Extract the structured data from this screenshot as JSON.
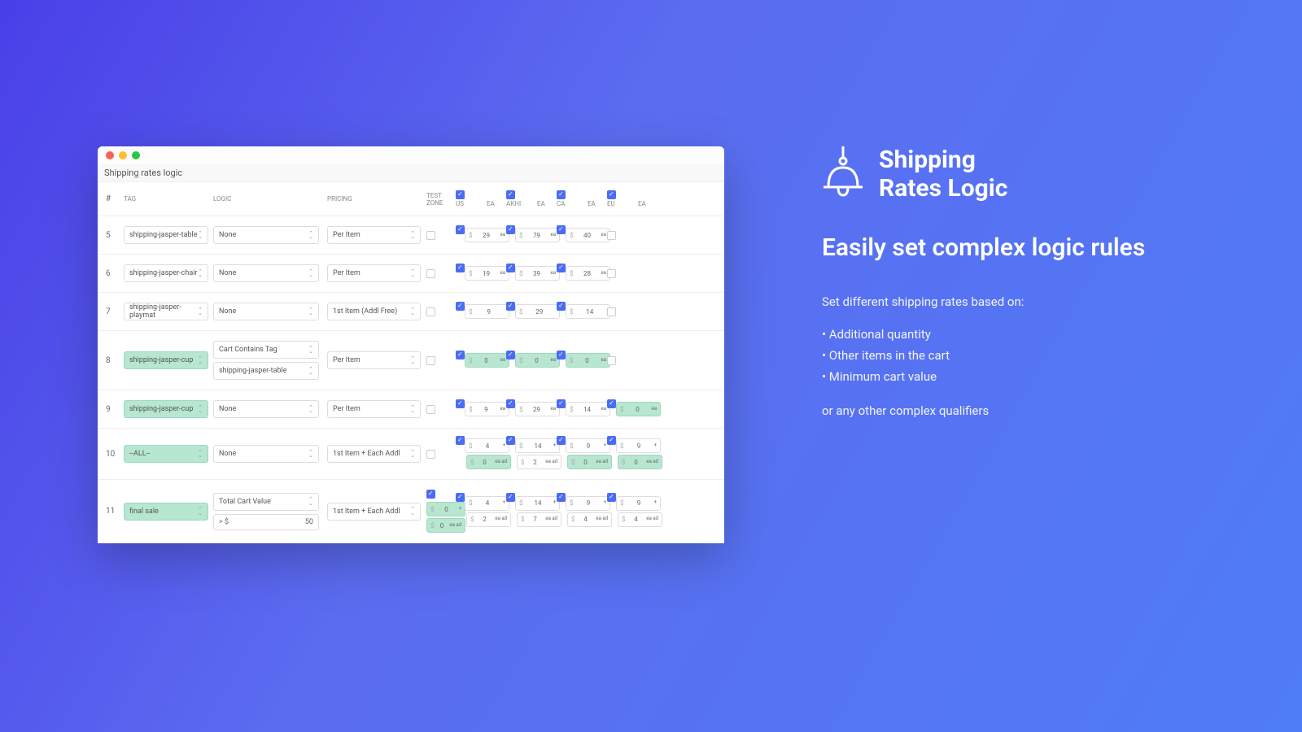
{
  "window": {
    "title": "Shipping rates logic"
  },
  "headers": {
    "num": "#",
    "tag": "TAG",
    "logic": "LOGIC",
    "pricing": "PRICING",
    "test": "TEST ZONE"
  },
  "zone_headers": [
    {
      "checked": true,
      "label": "US",
      "unit": "ea"
    },
    {
      "checked": true,
      "label": "AKHI",
      "unit": "ea"
    },
    {
      "checked": true,
      "label": "CA",
      "unit": "ea"
    },
    {
      "checked": true,
      "label": "EU",
      "unit": "ea"
    }
  ],
  "rows": [
    {
      "num": "5",
      "tag": "shipping-jasper-table",
      "tag_green": false,
      "logic": [
        {
          "text": "None",
          "sel": true
        }
      ],
      "pricing": "Per Item",
      "test": {
        "check": false,
        "prices": []
      },
      "zones": [
        {
          "checked": true,
          "boxes": [
            {
              "v": "29",
              "u": "ea"
            }
          ]
        },
        {
          "checked": true,
          "boxes": [
            {
              "v": "79",
              "u": "ea"
            }
          ]
        },
        {
          "checked": true,
          "boxes": [
            {
              "v": "40",
              "u": "ea"
            }
          ]
        },
        {
          "checked": false,
          "boxes": []
        }
      ]
    },
    {
      "num": "6",
      "tag": "shipping-jasper-chair",
      "tag_green": false,
      "logic": [
        {
          "text": "None",
          "sel": true
        }
      ],
      "pricing": "Per Item",
      "test": {
        "check": false,
        "prices": []
      },
      "zones": [
        {
          "checked": true,
          "boxes": [
            {
              "v": "19",
              "u": "ea"
            }
          ]
        },
        {
          "checked": true,
          "boxes": [
            {
              "v": "39",
              "u": "ea"
            }
          ]
        },
        {
          "checked": true,
          "boxes": [
            {
              "v": "28",
              "u": "ea"
            }
          ]
        },
        {
          "checked": false,
          "boxes": []
        }
      ]
    },
    {
      "num": "7",
      "tag": "shipping-jasper-playmat",
      "tag_green": false,
      "logic": [
        {
          "text": "None",
          "sel": true
        }
      ],
      "pricing": "1st Item (Addl Free)",
      "test": {
        "check": false,
        "prices": []
      },
      "zones": [
        {
          "checked": true,
          "boxes": [
            {
              "v": "9",
              "u": ""
            }
          ]
        },
        {
          "checked": true,
          "boxes": [
            {
              "v": "29",
              "u": ""
            }
          ]
        },
        {
          "checked": true,
          "boxes": [
            {
              "v": "14",
              "u": ""
            }
          ]
        },
        {
          "checked": false,
          "boxes": []
        }
      ]
    },
    {
      "num": "8",
      "tag": "shipping-jasper-cup",
      "tag_green": true,
      "logic": [
        {
          "text": "Cart Contains Tag",
          "sel": true
        },
        {
          "text": "shipping-jasper-table",
          "sel": true
        }
      ],
      "pricing": "Per Item",
      "test": {
        "check": false,
        "prices": []
      },
      "zones": [
        {
          "checked": true,
          "boxes": [
            {
              "v": "0",
              "u": "ea",
              "g": true
            }
          ]
        },
        {
          "checked": true,
          "boxes": [
            {
              "v": "0",
              "u": "ea",
              "g": true
            }
          ]
        },
        {
          "checked": true,
          "boxes": [
            {
              "v": "0",
              "u": "ea",
              "g": true
            }
          ]
        },
        {
          "checked": false,
          "boxes": []
        }
      ]
    },
    {
      "num": "9",
      "tag": "shipping-jasper-cup",
      "tag_green": true,
      "logic": [
        {
          "text": "None",
          "sel": true
        }
      ],
      "pricing": "Per Item",
      "test": {
        "check": false,
        "prices": []
      },
      "zones": [
        {
          "checked": true,
          "boxes": [
            {
              "v": "9",
              "u": "ea"
            }
          ]
        },
        {
          "checked": true,
          "boxes": [
            {
              "v": "29",
              "u": "ea"
            }
          ]
        },
        {
          "checked": true,
          "boxes": [
            {
              "v": "14",
              "u": "ea"
            }
          ]
        },
        {
          "checked": true,
          "boxes": [
            {
              "v": "0",
              "u": "ea",
              "g": true
            }
          ]
        }
      ]
    },
    {
      "num": "10",
      "tag": "--ALL--",
      "tag_green": true,
      "logic": [
        {
          "text": "None",
          "sel": true
        }
      ],
      "pricing": "1st Item + Each Addl",
      "test": {
        "check": false,
        "prices": []
      },
      "zones": [
        {
          "checked": true,
          "boxes": [
            {
              "v": "4",
              "u": "+"
            },
            {
              "v": "0",
              "u": "ea ad",
              "g": true
            }
          ]
        },
        {
          "checked": true,
          "boxes": [
            {
              "v": "14",
              "u": "+"
            },
            {
              "v": "2",
              "u": "ea ad"
            }
          ]
        },
        {
          "checked": true,
          "boxes": [
            {
              "v": "9",
              "u": "+"
            },
            {
              "v": "0",
              "u": "ea ad",
              "g": true
            }
          ]
        },
        {
          "checked": true,
          "boxes": [
            {
              "v": "9",
              "u": "+"
            },
            {
              "v": "0",
              "u": "ea ad",
              "g": true
            }
          ]
        }
      ]
    },
    {
      "num": "11",
      "tag": "final sale",
      "tag_green": true,
      "logic": [
        {
          "text": "Total Cart Value",
          "sel": true
        },
        {
          "text": "> $",
          "val": "50",
          "input": true
        }
      ],
      "pricing": "1st Item + Each Addl",
      "test": {
        "check": true,
        "prices": [
          {
            "v": "0",
            "u": "+",
            "g": true
          },
          {
            "v": "0",
            "u": "ea ad",
            "g": true
          }
        ]
      },
      "zones": [
        {
          "checked": true,
          "boxes": [
            {
              "v": "4",
              "u": "+"
            },
            {
              "v": "2",
              "u": "ea ad"
            }
          ]
        },
        {
          "checked": true,
          "boxes": [
            {
              "v": "14",
              "u": "+"
            },
            {
              "v": "7",
              "u": "ea ad"
            }
          ]
        },
        {
          "checked": true,
          "boxes": [
            {
              "v": "9",
              "u": "+"
            },
            {
              "v": "4",
              "u": "ea ad"
            }
          ]
        },
        {
          "checked": true,
          "boxes": [
            {
              "v": "9",
              "u": "+"
            },
            {
              "v": "4",
              "u": "ea ad"
            }
          ]
        }
      ]
    }
  ],
  "promo": {
    "brand1": "Shipping",
    "brand2": "Rates Logic",
    "tagline": "Easily set complex logic rules",
    "desc": "Set different shipping rates based on:",
    "bullets": [
      "Additional quantity",
      "Other items in the cart",
      "Minimum cart value"
    ],
    "footer": "or any other complex qualifiers"
  }
}
